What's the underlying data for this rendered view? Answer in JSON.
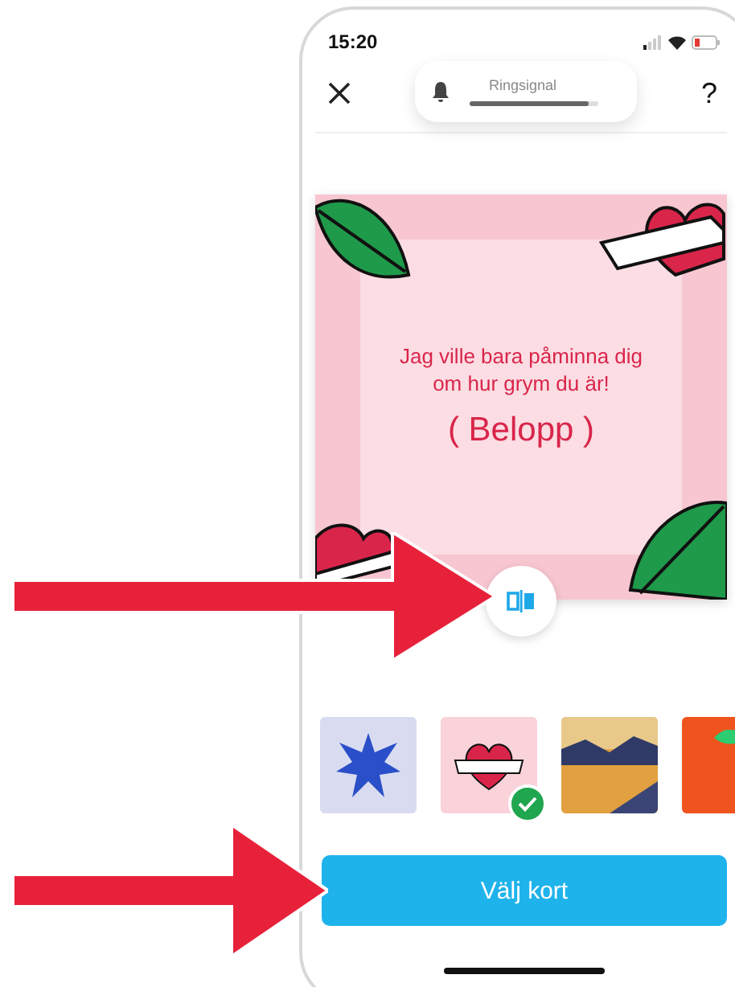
{
  "status_bar": {
    "time": "15:20"
  },
  "nav": {
    "help": "?"
  },
  "volume_toast": {
    "label": "Ringsignal",
    "level": 0.92
  },
  "card": {
    "message_lines": [
      "Jag ville bara påminna dig",
      "om hur grym du är!"
    ],
    "amount": "( Belopp )"
  },
  "thumbnails": [
    {
      "kind": "comic",
      "selected": false
    },
    {
      "kind": "heart",
      "selected": true
    },
    {
      "kind": "landscape",
      "selected": false
    },
    {
      "kind": "orange",
      "selected": false
    }
  ],
  "button": {
    "label": "Välj kort"
  }
}
